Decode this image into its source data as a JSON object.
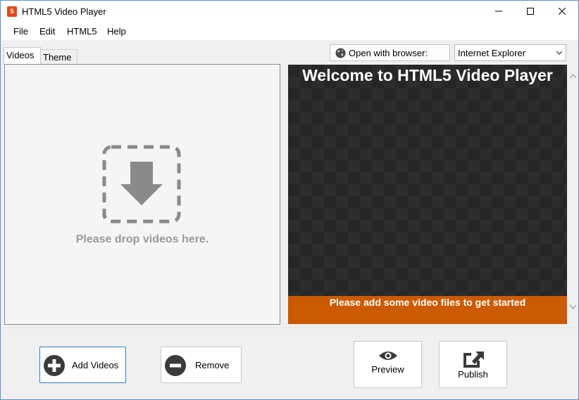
{
  "window": {
    "title": "HTML5 Video Player",
    "app_icon_glyph": "5"
  },
  "menu": {
    "items": [
      "File",
      "Edit",
      "HTML5",
      "Help"
    ]
  },
  "tabs": [
    {
      "label": "Videos",
      "active": true
    },
    {
      "label": "Theme",
      "active": false
    }
  ],
  "videos_panel": {
    "drop_hint": "Please drop videos here.",
    "icon": "drop-arrow-icon"
  },
  "browser": {
    "open_label": "Open with browser:",
    "selected": "Internet Explorer",
    "icon": "globe-icon"
  },
  "preview": {
    "title": "Welcome to HTML5 Video Player",
    "message": "Please add some video files to get started"
  },
  "buttons": {
    "add_videos": "Add Videos",
    "remove": "Remove",
    "preview": "Preview",
    "publish": "Publish"
  },
  "colors": {
    "accent": "#2f7fc1",
    "preview_bar": "#cc5a00",
    "preview_bg": "#262626"
  }
}
